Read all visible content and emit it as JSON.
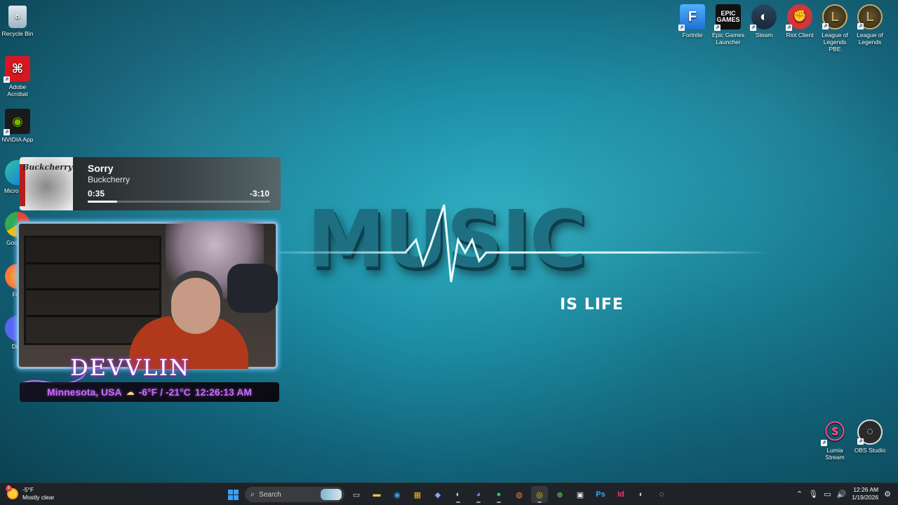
{
  "desktop": {
    "left_icons": [
      {
        "label": "Recycle Bin",
        "icon": "recycle-bin-icon"
      },
      {
        "label": "Adobe Acrobat",
        "icon": "adobe-acrobat-icon"
      },
      {
        "label": "NVIDIA App",
        "icon": "nvidia-icon"
      },
      {
        "label": "Micro Edg",
        "icon": "edge-icon"
      },
      {
        "label": "Goo Chr",
        "icon": "chrome-icon"
      },
      {
        "label": "Fire",
        "icon": "firefox-icon"
      },
      {
        "label": "Disc",
        "icon": "discord-icon"
      }
    ],
    "top_right_icons": [
      {
        "label": "Fortnite",
        "icon": "fortnite-icon",
        "glyph": "F",
        "color": "#2f8fe0"
      },
      {
        "label": "Epic Games Launcher",
        "icon": "epic-games-icon",
        "glyph": "EPIC GAMES",
        "color": "#1b1b1b"
      },
      {
        "label": "Steam",
        "icon": "steam-icon",
        "glyph": "◐",
        "color": "#1b2838"
      },
      {
        "label": "Riot Client",
        "icon": "riot-client-icon",
        "glyph": "✊",
        "color": "#d13639"
      },
      {
        "label": "League of Legends PBE",
        "icon": "league-pbe-icon",
        "glyph": "L",
        "color": "#3a3320"
      },
      {
        "label": "League of Legends",
        "icon": "league-icon",
        "glyph": "L",
        "color": "#3a3320"
      }
    ],
    "bottom_right_icons": [
      {
        "label": "Lumia Stream",
        "icon": "lumia-stream-icon"
      },
      {
        "label": "OBS Studio",
        "icon": "obs-studio-icon"
      }
    ]
  },
  "wallpaper": {
    "word": "MUSIC",
    "tagline": "IS LIFE"
  },
  "now_playing": {
    "title": "Sorry",
    "artist": "Buckcherry",
    "album_text": "Buckcherry",
    "elapsed": "0:35",
    "remaining": "-3:10",
    "progress": 0.16
  },
  "overlay": {
    "name": "DEVVLIN",
    "location": "Minnesota, USA",
    "temperature": "-6°F / -21°C",
    "time": "12:26:13 AM"
  },
  "taskbar": {
    "weather_temp": "-5°F",
    "weather_desc": "Mostly clear",
    "weather_badge": "5",
    "search_placeholder": "Search",
    "apps": [
      {
        "name": "file-explorer",
        "glyph": "▭",
        "color": "#cfcfcf"
      },
      {
        "name": "folder",
        "glyph": "▬",
        "color": "#f2c14e"
      },
      {
        "name": "edge",
        "glyph": "◉",
        "color": "#35a7e6"
      },
      {
        "name": "store",
        "glyph": "▦",
        "color": "#f2b01e"
      },
      {
        "name": "copilot",
        "glyph": "◆",
        "color": "#7aa7ff"
      },
      {
        "name": "steam",
        "glyph": "◐",
        "color": "#d0d6dd"
      },
      {
        "name": "discord",
        "glyph": "◕",
        "color": "#7b86ff"
      },
      {
        "name": "spotify",
        "glyph": "●",
        "color": "#1ed760"
      },
      {
        "name": "firefox",
        "glyph": "◍",
        "color": "#ff7a2a"
      },
      {
        "name": "chrome",
        "glyph": "◎",
        "color": "#f5c518"
      },
      {
        "name": "xbox",
        "glyph": "⊗",
        "color": "#4cc24c"
      },
      {
        "name": "games",
        "glyph": "▣",
        "color": "#e6e6e6"
      },
      {
        "name": "photoshop",
        "glyph": "Ps",
        "color": "#31a8ff"
      },
      {
        "name": "indesign",
        "glyph": "Id",
        "color": "#ff3366"
      },
      {
        "name": "steam-2",
        "glyph": "◐",
        "color": "#d0d6dd"
      },
      {
        "name": "obs",
        "glyph": "◌",
        "color": "#e6e6e6"
      }
    ],
    "clock_time": "12:26 AM",
    "clock_date": "1/19/2026"
  }
}
